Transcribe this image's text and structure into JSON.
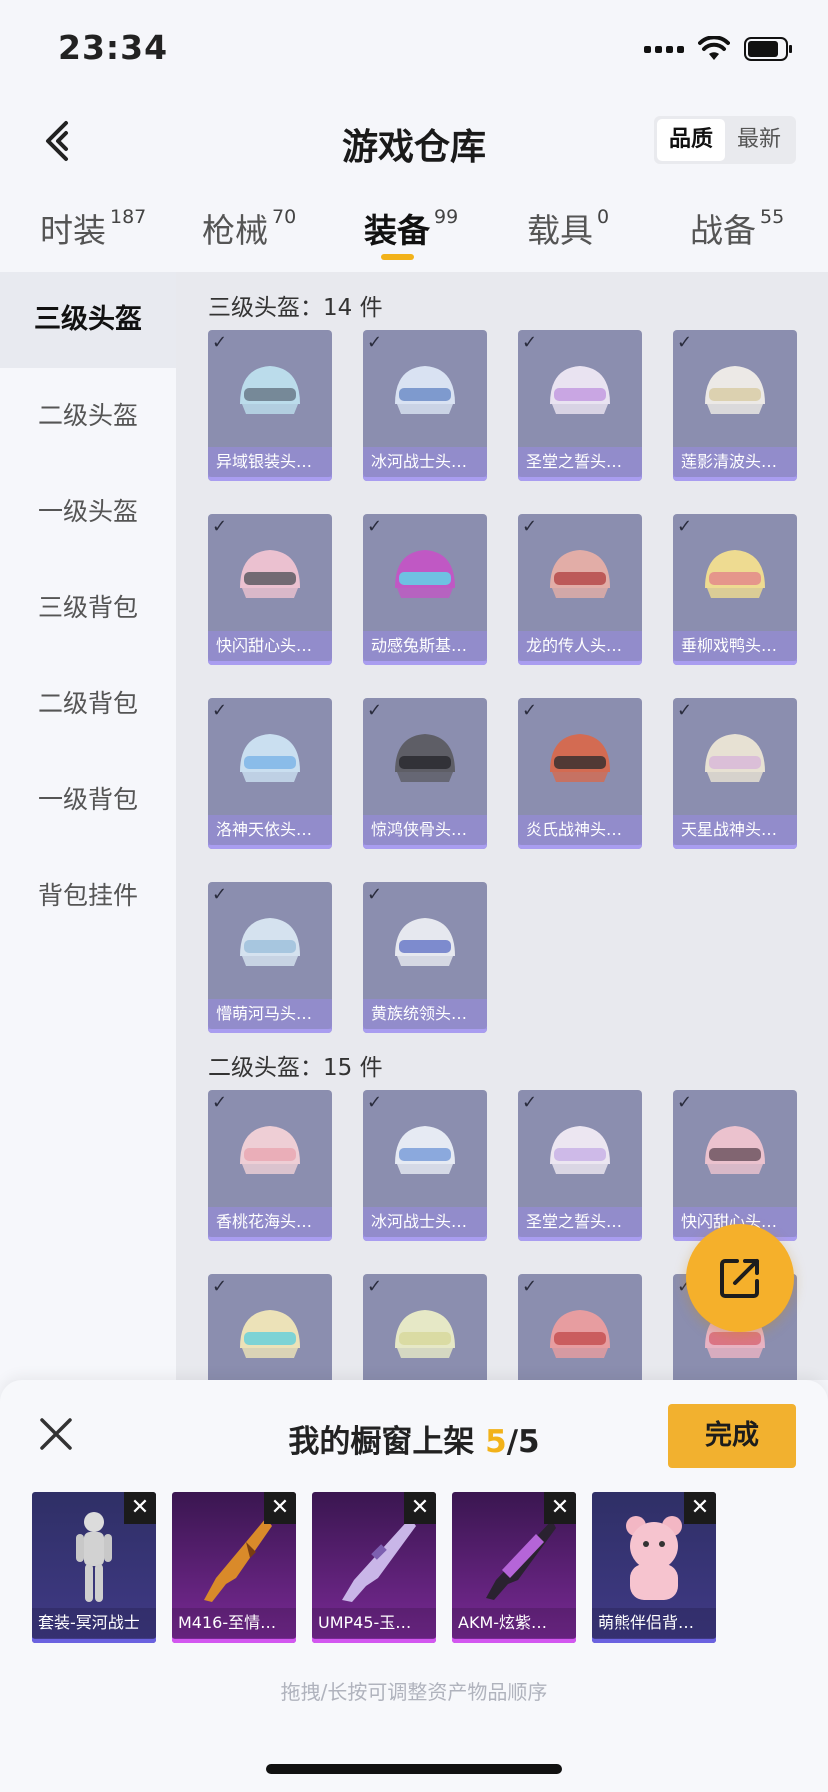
{
  "status_bar": {
    "time": "23:34"
  },
  "header": {
    "title": "游戏仓库",
    "sort_options": [
      "品质",
      "最新"
    ],
    "sort_active": 0
  },
  "tabs": [
    {
      "label": "时装",
      "count": "187"
    },
    {
      "label": "枪械",
      "count": "70"
    },
    {
      "label": "装备",
      "count": "99"
    },
    {
      "label": "载具",
      "count": "0"
    },
    {
      "label": "战备",
      "count": "55"
    }
  ],
  "active_tab": 2,
  "side_nav": [
    "三级头盔",
    "二级头盔",
    "一级头盔",
    "三级背包",
    "二级背包",
    "一级背包",
    "背包挂件"
  ],
  "side_nav_active": 0,
  "sections": [
    {
      "title": "三级头盔：14 件",
      "items": [
        "异域银装头…",
        "冰河战士头…",
        "圣堂之誓头…",
        "莲影清波头…",
        "快闪甜心头…",
        "动感兔斯基…",
        "龙的传人头…",
        "垂柳戏鸭头…",
        "洛神天依头…",
        "惊鸿侠骨头…",
        "炎氏战神头…",
        "天星战神头…",
        "懵萌河马头…",
        "黄族统领头…"
      ]
    },
    {
      "title": "二级头盔：15 件",
      "items": [
        "香桃花海头…",
        "冰河战士头…",
        "圣堂之誓头…",
        "快闪甜心头…",
        "",
        "",
        "",
        ""
      ]
    }
  ],
  "bottom_sheet": {
    "title_prefix": "我的橱窗上架 ",
    "count_current": "5",
    "count_sep_total": "/5",
    "done_label": "完成",
    "remove_glyph": "✕",
    "showcase": [
      {
        "name": "套装-冥河战士",
        "style": "dark"
      },
      {
        "name": "M416-至情…",
        "style": "purple"
      },
      {
        "name": "UMP45-玉…",
        "style": "purple"
      },
      {
        "name": "AKM-炫紫…",
        "style": "purple"
      },
      {
        "name": "萌熊伴侣背…",
        "style": "dark"
      }
    ],
    "hint": "拖拽/长按可调整资产物品顺序"
  },
  "icons": {
    "back": "chevron-left-icon",
    "close": "close-icon",
    "share": "share-icon",
    "check": "check-icon",
    "accent_color": "#f2b21a"
  }
}
